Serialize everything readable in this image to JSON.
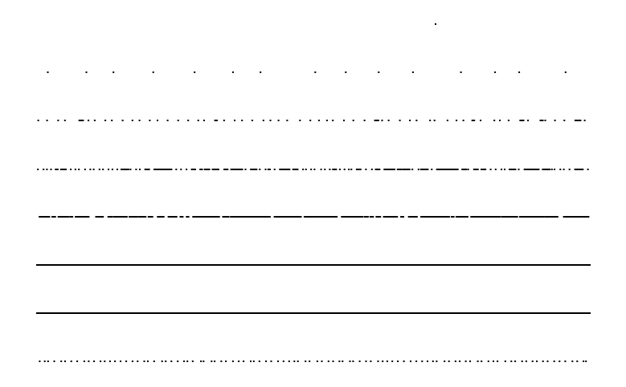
{
  "page": {
    "background": "#ffffff",
    "ink_color": "#000000"
  },
  "rows": [
    {
      "id": "row-1",
      "kind": "sparse-dots",
      "mark_count": 1
    },
    {
      "id": "row-2",
      "kind": "sparse-dots",
      "mark_count": 15
    },
    {
      "id": "row-3",
      "kind": "dots-and-dashes",
      "mark_count": 60
    },
    {
      "id": "row-4",
      "kind": "dense-dots-and-dashes",
      "mark_count": 120
    },
    {
      "id": "row-5",
      "kind": "mostly-dashes",
      "mark_count": 90
    },
    {
      "id": "row-6",
      "kind": "solid-line"
    },
    {
      "id": "row-7",
      "kind": "solid-line"
    },
    {
      "id": "row-8",
      "kind": "dots",
      "mark_count": 100
    }
  ]
}
